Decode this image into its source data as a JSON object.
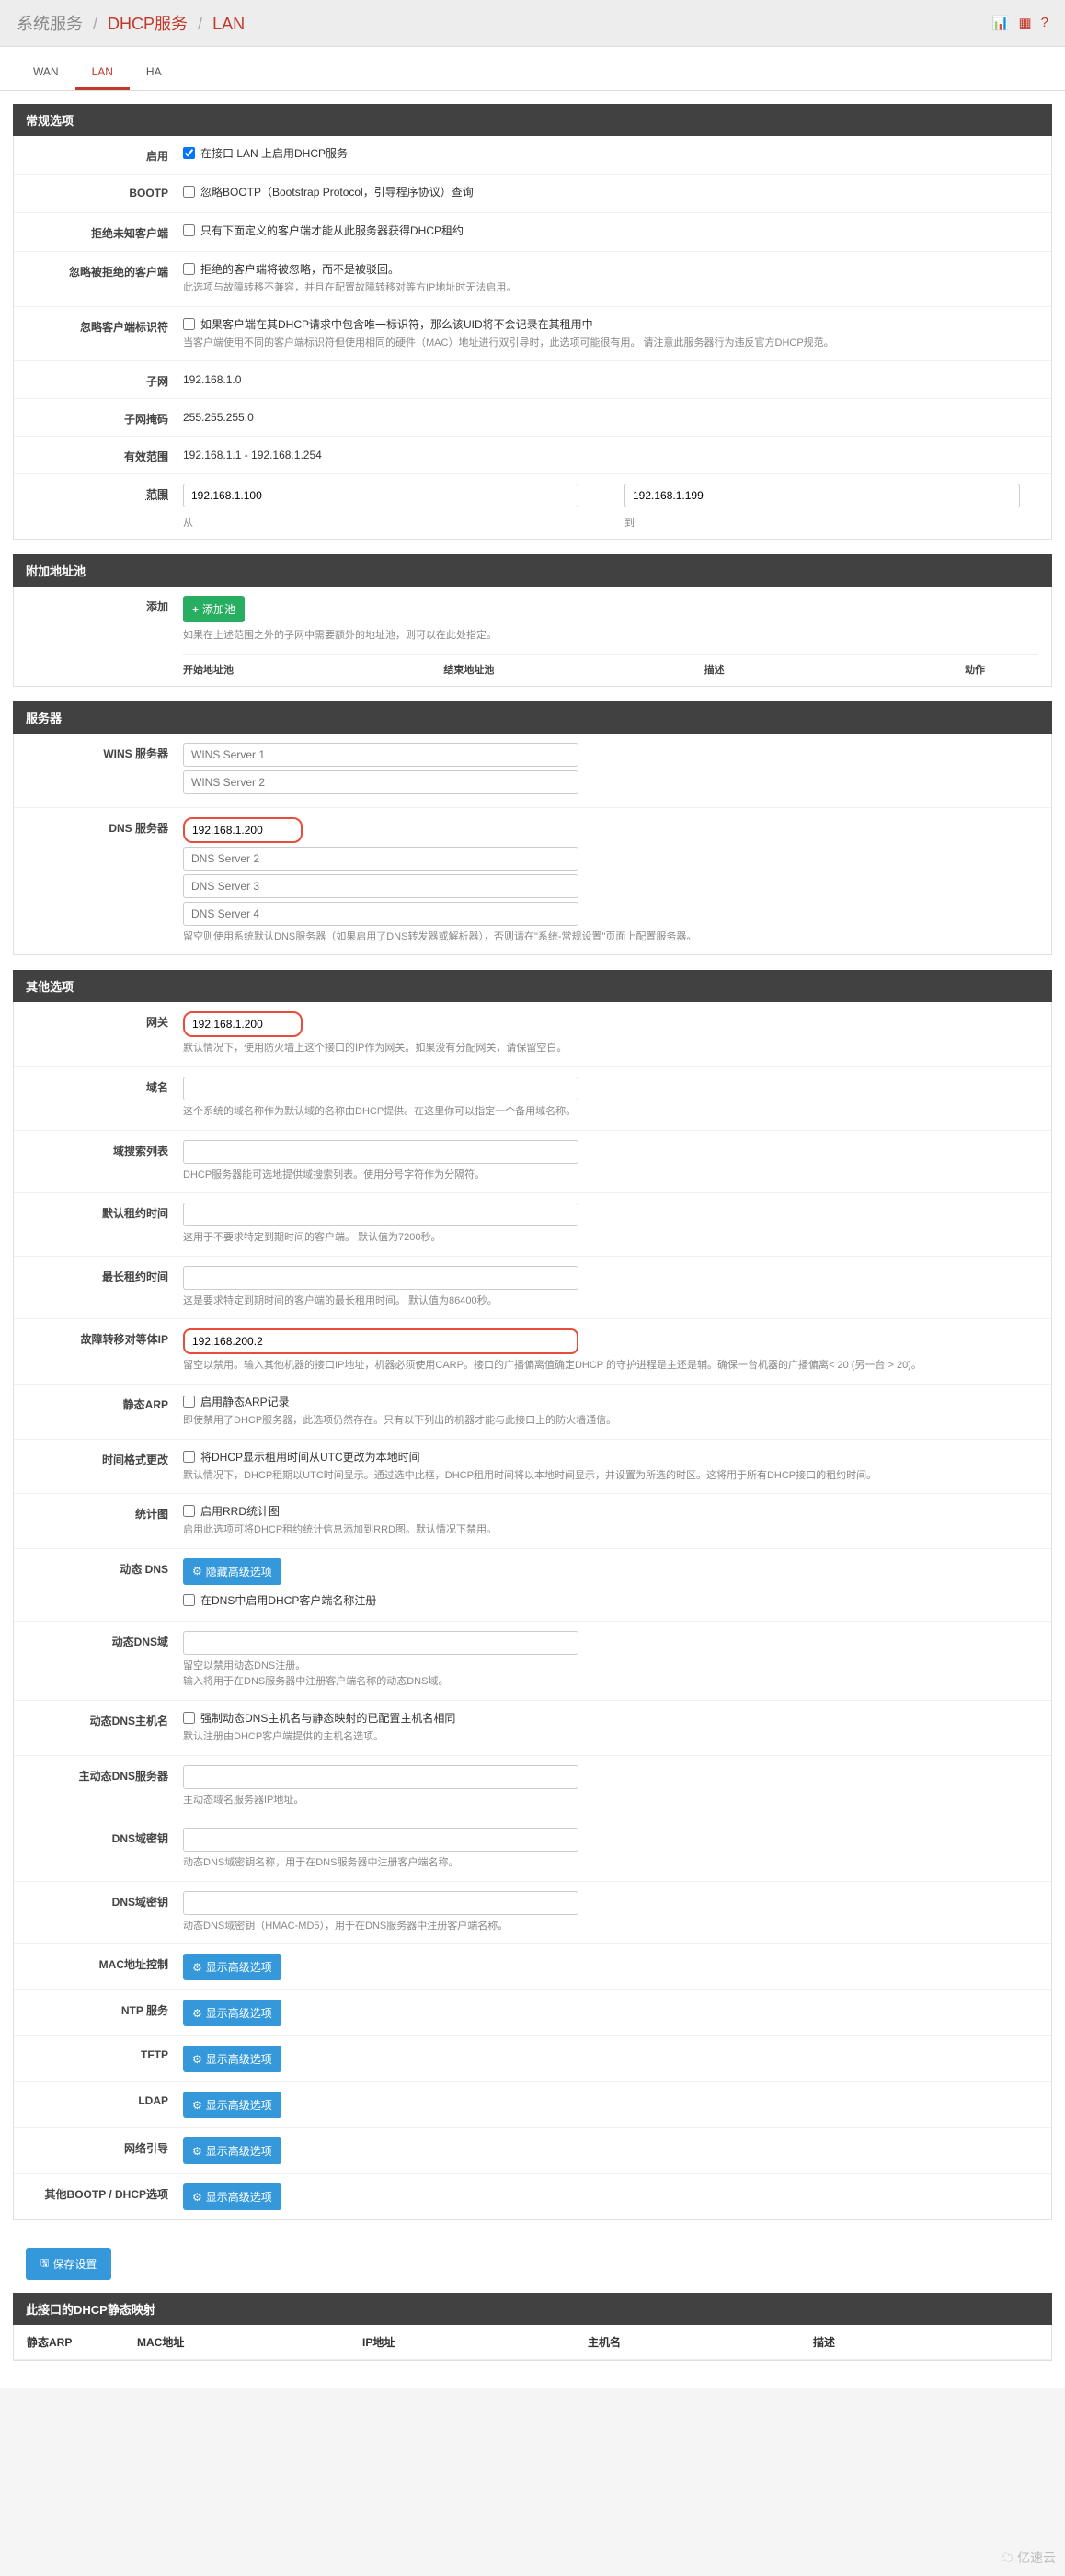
{
  "breadcrumb": {
    "a": "系统服务",
    "b": "DHCP服务",
    "c": "LAN"
  },
  "tabs": {
    "wan": "WAN",
    "lan": "LAN",
    "ha": "HA"
  },
  "sections": {
    "general": "常规选项",
    "pool": "附加地址池",
    "servers": "服务器",
    "other": "其他选项",
    "static_map": "此接口的DHCP静态映射"
  },
  "general": {
    "enable": {
      "label": "启用",
      "text": "在接口 LAN 上启用DHCP服务"
    },
    "bootp": {
      "label": "BOOTP",
      "text": "忽略BOOTP（Bootstrap Protocol，引导程序协议）查询"
    },
    "deny_unknown": {
      "label": "拒绝未知客户端",
      "text": "只有下面定义的客户端才能从此服务器获得DHCP租约"
    },
    "ignore_denied": {
      "label": "忽略被拒绝的客户端",
      "text": "拒绝的客户端将被忽略，而不是被驳回。",
      "help": "此选项与故障转移不兼容，并且在配置故障转移对等方IP地址时无法启用。"
    },
    "ignore_client_id": {
      "label": "忽略客户端标识符",
      "text": "如果客户端在其DHCP请求中包含唯一标识符，那么该UID将不会记录在其租用中",
      "help": "当客户端使用不同的客户端标识符但使用相同的硬件（MAC）地址进行双引导时，此选项可能很有用。 请注意此服务器行为违反官方DHCP规范。"
    },
    "subnet": {
      "label": "子网",
      "value": "192.168.1.0"
    },
    "mask": {
      "label": "子网掩码",
      "value": "255.255.255.0"
    },
    "avail": {
      "label": "有效范围",
      "value": "192.168.1.1 - 192.168.1.254"
    },
    "range": {
      "label": "范围",
      "from": "192.168.1.100",
      "to": "192.168.1.199",
      "from_label": "从",
      "to_label": "到"
    }
  },
  "pool": {
    "add_label": "添加",
    "add_btn": "添加池",
    "help": "如果在上述范围之外的子网中需要额外的地址池，则可以在此处指定。",
    "cols": {
      "start": "开始地址池",
      "end": "结束地址池",
      "desc": "描述",
      "actions": "动作"
    }
  },
  "servers": {
    "wins": {
      "label": "WINS 服务器",
      "p1": "WINS Server 1",
      "p2": "WINS Server 2"
    },
    "dns": {
      "label": "DNS 服务器",
      "v1": "192.168.1.200",
      "p2": "DNS Server 2",
      "p3": "DNS Server 3",
      "p4": "DNS Server 4",
      "help": "留空则使用系统默认DNS服务器（如果启用了DNS转发器或解析器），否则请在\"系统-常规设置\"页面上配置服务器。"
    }
  },
  "other": {
    "gateway": {
      "label": "网关",
      "value": "192.168.1.200",
      "help": "默认情况下，使用防火墙上这个接口的IP作为网关。如果没有分配网关，请保留空白。"
    },
    "domain": {
      "label": "域名",
      "help": "这个系统的域名称作为默认域的名称由DHCP提供。在这里你可以指定一个备用域名称。"
    },
    "search": {
      "label": "域搜索列表",
      "help": "DHCP服务器能可选地提供域搜索列表。使用分号字符作为分隔符。"
    },
    "default_lease": {
      "label": "默认租约时间",
      "help": "这用于不要求特定到期时间的客户端。 默认值为7200秒。"
    },
    "max_lease": {
      "label": "最长租约时间",
      "help": "这是要求特定到期时间的客户端的最长租用时间。 默认值为86400秒。"
    },
    "failover": {
      "label": "故障转移对等体IP",
      "value": "192.168.200.2",
      "help": "留空以禁用。输入其他机器的接口IP地址，机器必须使用CARP。接口的广播偏离值确定DHCP 的守护进程是主还是辅。确保一台机器的广播偏离< 20 (另一台 > 20)。"
    },
    "static_arp": {
      "label": "静态ARP",
      "text": "启用静态ARP记录",
      "help": "即使禁用了DHCP服务器，此选项仍然存在。只有以下列出的机器才能与此接口上的防火墙通信。"
    },
    "time_format": {
      "label": "时间格式更改",
      "text": "将DHCP显示租用时间从UTC更改为本地时间",
      "help": "默认情况下，DHCP租期以UTC时间显示。通过选中此框，DHCP租用时间将以本地时间显示，并设置为所选的时区。这将用于所有DHCP接口的租约时间。"
    },
    "stats": {
      "label": "统计图",
      "text": "启用RRD统计图",
      "help": "启用此选项可将DHCP租约统计信息添加到RRD图。默认情况下禁用。"
    },
    "ddns": {
      "label": "动态 DNS",
      "btn": "隐藏高级选项",
      "text": "在DNS中启用DHCP客户端名称注册"
    },
    "ddns_domain": {
      "label": "动态DNS域",
      "help": "留空以禁用动态DNS注册。",
      "help2": "输入将用于在DNS服务器中注册客户端名称的动态DNS域。"
    },
    "ddns_hostname": {
      "label": "动态DNS主机名",
      "text": "强制动态DNS主机名与静态映射的已配置主机名相同",
      "help": "默认注册由DHCP客户端提供的主机名选项。"
    },
    "ddns_primary": {
      "label": "主动态DNS服务器",
      "help": "主动态域名服务器IP地址。"
    },
    "ddns_key_name": {
      "label": "DNS域密钥",
      "help": "动态DNS域密钥名称，用于在DNS服务器中注册客户端名称。"
    },
    "ddns_key_secret": {
      "label": "DNS域密钥",
      "help": "动态DNS域密钥（HMAC-MD5），用于在DNS服务器中注册客户端名称。"
    },
    "mac": {
      "label": "MAC地址控制",
      "btn": "显示高级选项"
    },
    "ntp": {
      "label": "NTP 服务",
      "btn": "显示高级选项"
    },
    "tftp": {
      "label": "TFTP",
      "btn": "显示高级选项"
    },
    "ldap": {
      "label": "LDAP",
      "btn": "显示高级选项"
    },
    "netboot": {
      "label": "网络引导",
      "btn": "显示高级选项"
    },
    "bootp_opts": {
      "label": "其他BOOTP / DHCP选项",
      "btn": "显示高级选项"
    }
  },
  "save_btn": "保存设置",
  "static_map_cols": {
    "arp": "静态ARP",
    "mac": "MAC地址",
    "ip": "IP地址",
    "host": "主机名",
    "desc": "描述"
  },
  "watermark": "亿速云"
}
